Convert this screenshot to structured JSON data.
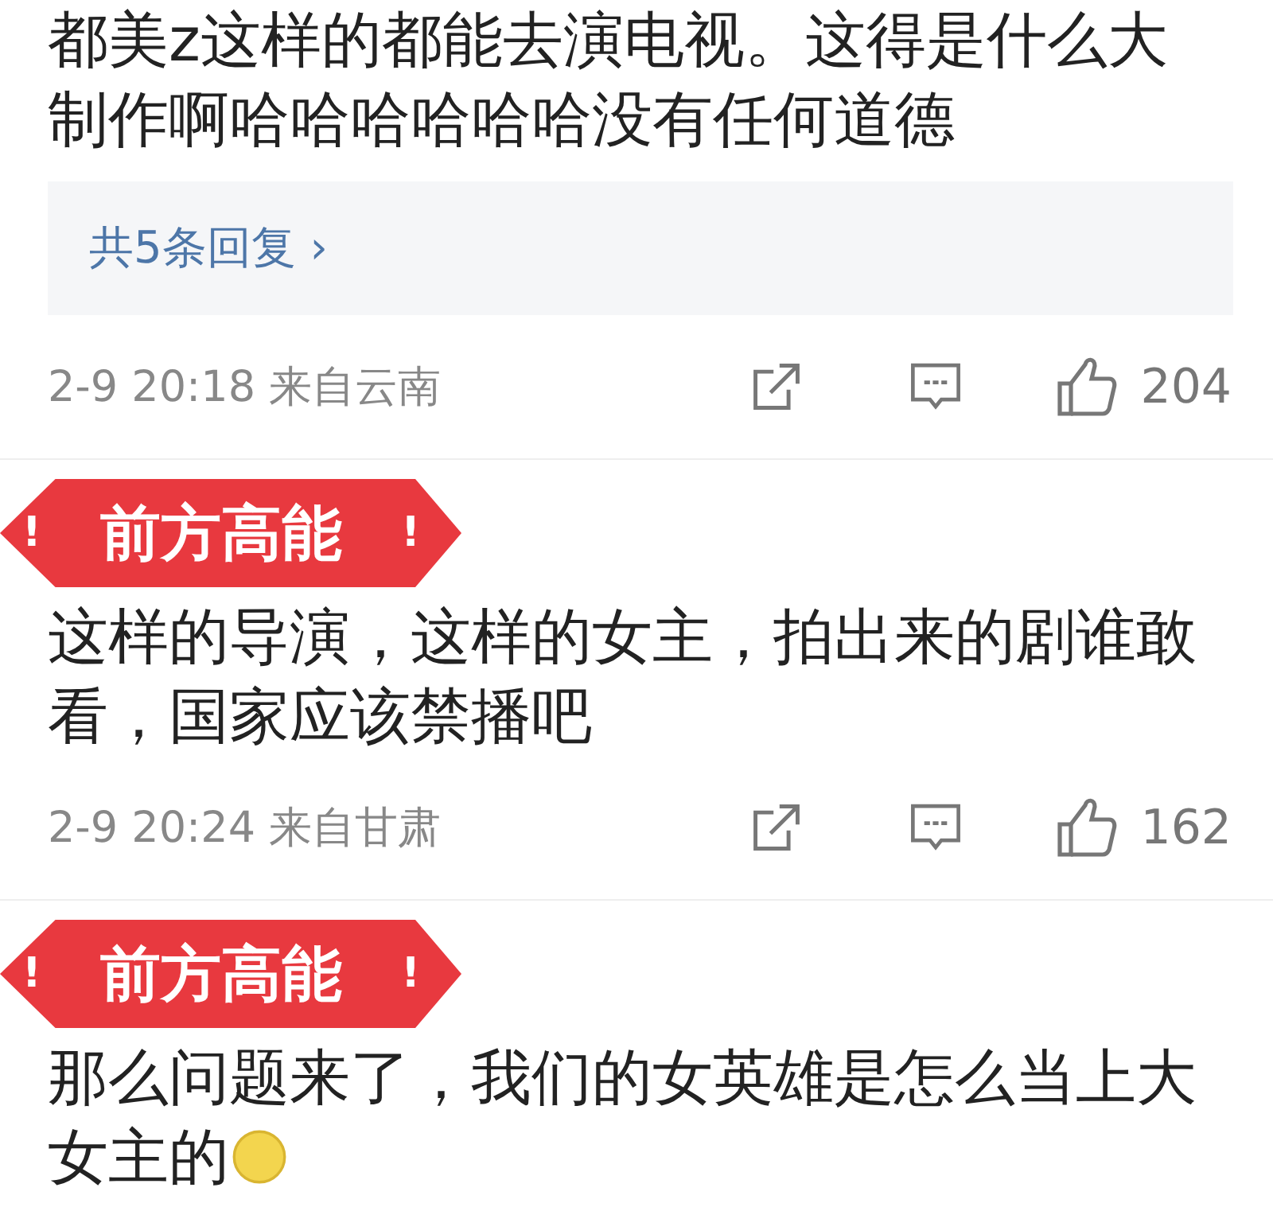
{
  "comments": [
    {
      "text": "都美z这样的都能去演电视。这得是什么大制作啊哈哈哈哈哈哈没有任何道德",
      "emoji": false,
      "replies": "共5条回复",
      "reply_arrow": "›",
      "meta": "2-9 20:18 来自云南",
      "likes": "204"
    },
    {
      "badge": {
        "text": "前方高能",
        "mark": "!"
      },
      "text": "这样的导演，这样的女主，拍出来的剧谁敢看，国家应该禁播吧",
      "emoji": false,
      "meta": "2-9 20:24 来自甘肃",
      "likes": "162"
    },
    {
      "badge": {
        "text": "前方高能",
        "mark": "!"
      },
      "text": "那么问题来了，我们的女英雄是怎么当上大女主的",
      "emoji": true
    }
  ]
}
